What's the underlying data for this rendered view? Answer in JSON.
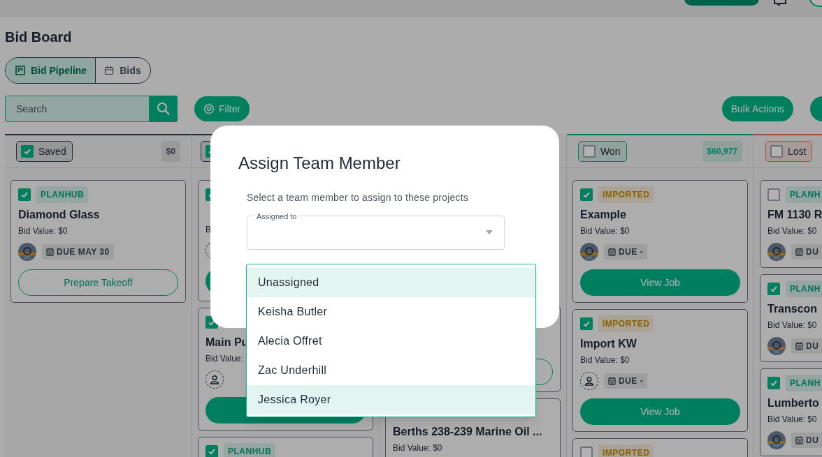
{
  "page_title": "Bid Board",
  "view_tabs": [
    {
      "label": "Bid Pipeline",
      "selected": true,
      "kind": "board"
    },
    {
      "label": "Bids",
      "selected": false,
      "kind": "calendar"
    }
  ],
  "search": {
    "placeholder": "Search"
  },
  "filter_button": "Filter",
  "bulk_actions_button": "Bulk Actions",
  "columns": [
    {
      "title": "Saved",
      "checked": true,
      "total": "$0",
      "kind": "neutral",
      "cards": [
        {
          "checked": true,
          "source": {
            "label": "PLANHUB",
            "kind": "planhub"
          },
          "title": "Diamond Glass",
          "bid_value": "Bid Value: $0",
          "assigned": true,
          "due": "DUE MAY 30",
          "action": "Prepare Takeoff",
          "outlined": true
        }
      ]
    },
    {
      "checked": true,
      "kind": "neutral",
      "cards": [
        {
          "checked": true,
          "bid_value": "B",
          "assigned": false,
          "outlined": false
        },
        {
          "checked": true,
          "title": "Main Pu",
          "bid_value": "Bid Value:",
          "assigned": false,
          "outlined": false
        },
        {
          "checked": true,
          "source": {
            "label": "PLANHUB",
            "kind": "planhub"
          }
        }
      ]
    },
    {
      "cards": [
        {
          "outlined": true
        },
        {
          "title": "Berths 238-239 Marine Oil ...",
          "bid_value": "Bid Value: $0"
        }
      ]
    },
    {
      "title": "Won",
      "checked": false,
      "total": "$60,977",
      "kind": "success",
      "cards": [
        {
          "checked": true,
          "source": {
            "label": "IMPORTED",
            "kind": "imported"
          },
          "title": "Example",
          "bid_value": "Bid Value: $0",
          "assigned": true,
          "due": "DUE -",
          "action": "View Job",
          "outlined": false
        },
        {
          "checked": true,
          "source": {
            "label": "IMPORTED",
            "kind": "imported"
          },
          "title": "Import KW",
          "bid_value": "Bid Value: $0",
          "assigned": false,
          "due": "DUE -",
          "action": "View Job",
          "outlined": false
        },
        {
          "checked": false,
          "source": {
            "label": "IMPORTED",
            "kind": "imported"
          }
        }
      ]
    },
    {
      "title": "Lost",
      "checked": false,
      "kind": "danger",
      "cards": [
        {
          "checked": false,
          "source": {
            "label": "PLANH",
            "kind": "planhub"
          },
          "title": "FM 1130 R",
          "bid_value": "Bid Value: $0",
          "assigned": true,
          "due": "DU"
        },
        {
          "checked": true,
          "source": {
            "label": "PLANH",
            "kind": "planhub"
          },
          "title": "Transcon",
          "bid_value": "Bid Value: $0",
          "assigned": true,
          "due": "DU"
        },
        {
          "checked": true,
          "source": {
            "label": "PLANH",
            "kind": "planhub"
          },
          "title": "Lumberto",
          "bid_value": "Bid Value: $0",
          "assigned": true,
          "due": "DU"
        }
      ]
    }
  ],
  "modal": {
    "title": "Assign Team Member",
    "description": "Select a team member to assign to these projects",
    "field": {
      "label": "Assigned to"
    },
    "options": [
      {
        "label": "Unassigned",
        "highlighted": true
      },
      {
        "label": "Keisha Butler",
        "highlighted": false
      },
      {
        "label": "Alecia Offret",
        "highlighted": false
      },
      {
        "label": "Zac Underhill",
        "highlighted": false
      },
      {
        "label": "Jessica Royer",
        "highlighted": true
      }
    ]
  }
}
